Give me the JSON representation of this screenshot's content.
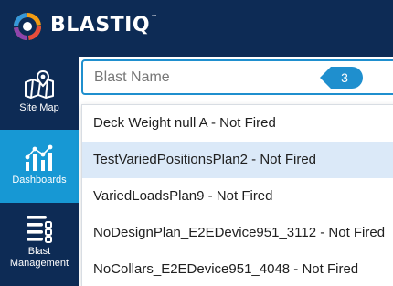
{
  "brand": {
    "name": "BLAST",
    "suffix": "IQ",
    "trademark": "™"
  },
  "nav": [
    {
      "label": "Site Map",
      "icon": "map-pin-icon"
    },
    {
      "label": "Dashboards",
      "icon": "dashboard-chart-icon",
      "active": true
    },
    {
      "label": "Blast\nManagement",
      "icon": "list-management-icon"
    }
  ],
  "search": {
    "placeholder": "Blast Name",
    "value": "",
    "badge": "3"
  },
  "options": [
    "Deck Weight null A - Not Fired",
    "TestVariedPositionsPlan2 - Not Fired",
    "VariedLoadsPlan9 - Not Fired",
    "NoDesignPlan_E2EDevice951_3112 - Not Fired",
    "NoCollars_E2EDevice951_4048 - Not Fired"
  ],
  "selected_option_index": 1,
  "colors": {
    "navy": "#0d2b55",
    "accent": "#1798d4",
    "border": "#1f8fce",
    "highlight": "#dbe9f8"
  }
}
